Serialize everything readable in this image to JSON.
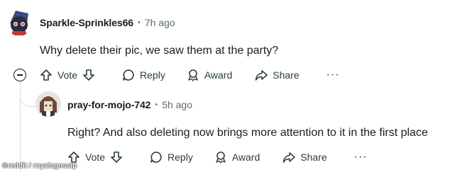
{
  "comments": [
    {
      "username": "Sparkle-Sprinkles66",
      "separator": "•",
      "time": "7h ago",
      "text": "Why delete their pic, we saw them at the party?",
      "vote_label": "Vote",
      "reply_label": "Reply",
      "award_label": "Award",
      "share_label": "Share",
      "more_label": "···"
    },
    {
      "username": "pray-for-mojo-742",
      "separator": "•",
      "time": "5h ago",
      "text": "Right? And also deleting now brings more attention to it in the first place",
      "vote_label": "Vote",
      "reply_label": "Reply",
      "award_label": "Award",
      "share_label": "Share",
      "more_label": "···"
    }
  ],
  "watermark": "©reddit / royalsgossip",
  "colors": {
    "text": "#1c1c1c",
    "muted": "#5c6c74",
    "thread": "#d9dcde"
  }
}
